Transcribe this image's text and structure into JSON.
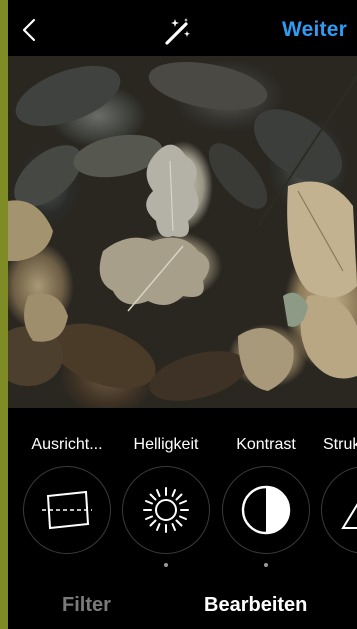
{
  "header": {
    "next_label": "Weiter"
  },
  "tools": [
    {
      "label": "Ausricht...",
      "icon": "straighten-icon",
      "active_dot": false
    },
    {
      "label": "Helligkeit",
      "icon": "brightness-sun-icon",
      "active_dot": true
    },
    {
      "label": "Kontrast",
      "icon": "contrast-icon",
      "active_dot": true
    },
    {
      "label": "Struktur",
      "icon": "structure-triangle-icon",
      "active_dot": false
    }
  ],
  "tabs": {
    "filter_label": "Filter",
    "edit_label": "Bearbeiten",
    "active": "edit"
  },
  "colors": {
    "accent": "#2f9cf4",
    "background": "#000000",
    "frame": "#7f8b24"
  }
}
